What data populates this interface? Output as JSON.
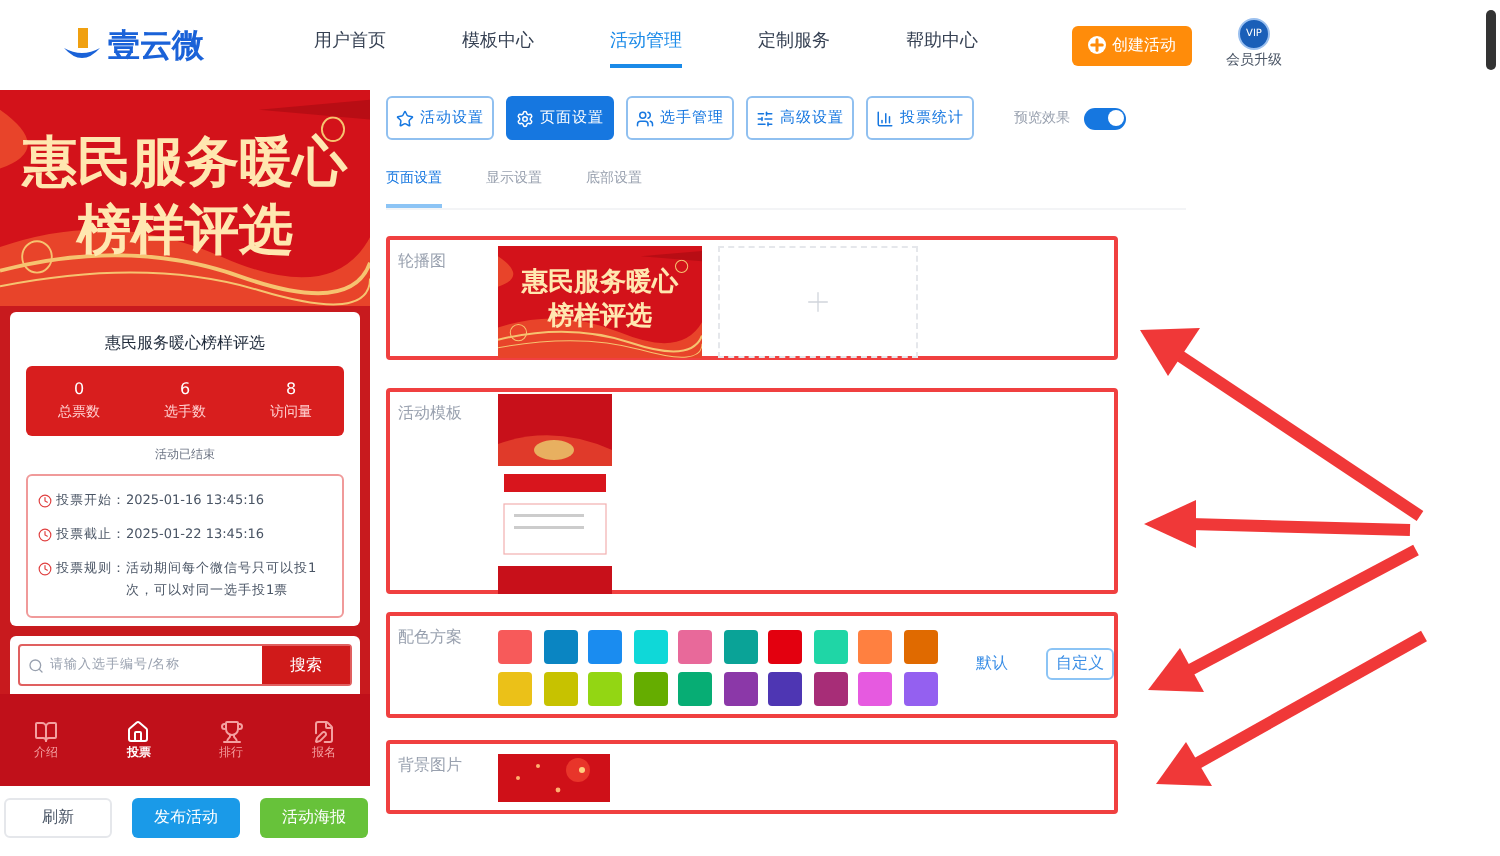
{
  "header": {
    "logo_text": "壹云微",
    "nav": [
      {
        "label": "用户首页",
        "selected": false
      },
      {
        "label": "模板中心",
        "selected": false
      },
      {
        "label": "活动管理",
        "selected": true
      },
      {
        "label": "定制服务",
        "selected": false
      },
      {
        "label": "帮助中心",
        "selected": false
      }
    ],
    "create_button": "创建活动",
    "vip_badge": "VIP",
    "vip_label": "会员升级"
  },
  "preview": {
    "banner_lines": [
      "惠民服务暖心",
      "榜样评选"
    ],
    "card_title": "惠民服务暖心榜样评选",
    "stats": [
      {
        "value": "0",
        "label": "总票数"
      },
      {
        "value": "6",
        "label": "选手数"
      },
      {
        "value": "8",
        "label": "访问量"
      }
    ],
    "status": "活动已结束",
    "info": [
      {
        "label": "投票开始：",
        "value": "2025-01-16 13:45:16"
      },
      {
        "label": "投票截止：",
        "value": "2025-01-22 13:45:16"
      },
      {
        "label": "投票规则：",
        "value": "活动期间每个微信号只可以投1次，可以对同一选手投1票"
      }
    ],
    "search": {
      "placeholder": "请输入选手编号/名称",
      "button": "搜索"
    },
    "bottom_nav": [
      {
        "label": "介绍",
        "selected": false
      },
      {
        "label": "投票",
        "selected": true
      },
      {
        "label": "排行",
        "selected": false
      },
      {
        "label": "报名",
        "selected": false
      }
    ]
  },
  "actions": [
    {
      "label": "刷新",
      "kind": "plain"
    },
    {
      "label": "发布活动",
      "kind": "primary"
    },
    {
      "label": "活动海报",
      "kind": "success"
    }
  ],
  "toolbar": [
    {
      "label": "活动设置",
      "selected": false
    },
    {
      "label": "页面设置",
      "selected": true
    },
    {
      "label": "选手管理",
      "selected": false
    },
    {
      "label": "高级设置",
      "selected": false
    },
    {
      "label": "投票统计",
      "selected": false
    }
  ],
  "preview_toggle": {
    "label": "预览效果",
    "on": true
  },
  "subtabs": [
    {
      "label": "页面设置",
      "selected": true
    },
    {
      "label": "显示设置",
      "selected": false
    },
    {
      "label": "底部设置",
      "selected": false
    }
  ],
  "sections": [
    {
      "kind": "carousel",
      "label": "轮播图",
      "banner_lines": [
        "惠民服务暖心",
        "榜样评选"
      ]
    },
    {
      "kind": "template",
      "label": "活动模板"
    },
    {
      "kind": "colors",
      "label": "配色方案",
      "swatches": [
        {
          "color": "#f75a5a"
        },
        {
          "color": "#0a85c2"
        },
        {
          "color": "#1a8cf0"
        },
        {
          "color": "#0fd8d8"
        },
        {
          "color": "#e8699a"
        },
        {
          "color": "#0aa397"
        },
        {
          "color": "#e3000f"
        },
        {
          "color": "#1fd6a6"
        },
        {
          "color": "#ff8040"
        },
        {
          "color": "#e06a00"
        },
        {
          "color": "#ebc118"
        },
        {
          "color": "#c7c200"
        },
        {
          "color": "#93d613"
        },
        {
          "color": "#65ad00"
        },
        {
          "color": "#07ad74"
        },
        {
          "color": "#8b38a8"
        },
        {
          "color": "#4e36b3"
        },
        {
          "color": "#a72d77"
        },
        {
          "color": "#e65ae0"
        },
        {
          "color": "#9460f0"
        }
      ],
      "default_label": "默认",
      "custom_button": "自定义"
    },
    {
      "kind": "background",
      "label": "背景图片"
    }
  ]
}
